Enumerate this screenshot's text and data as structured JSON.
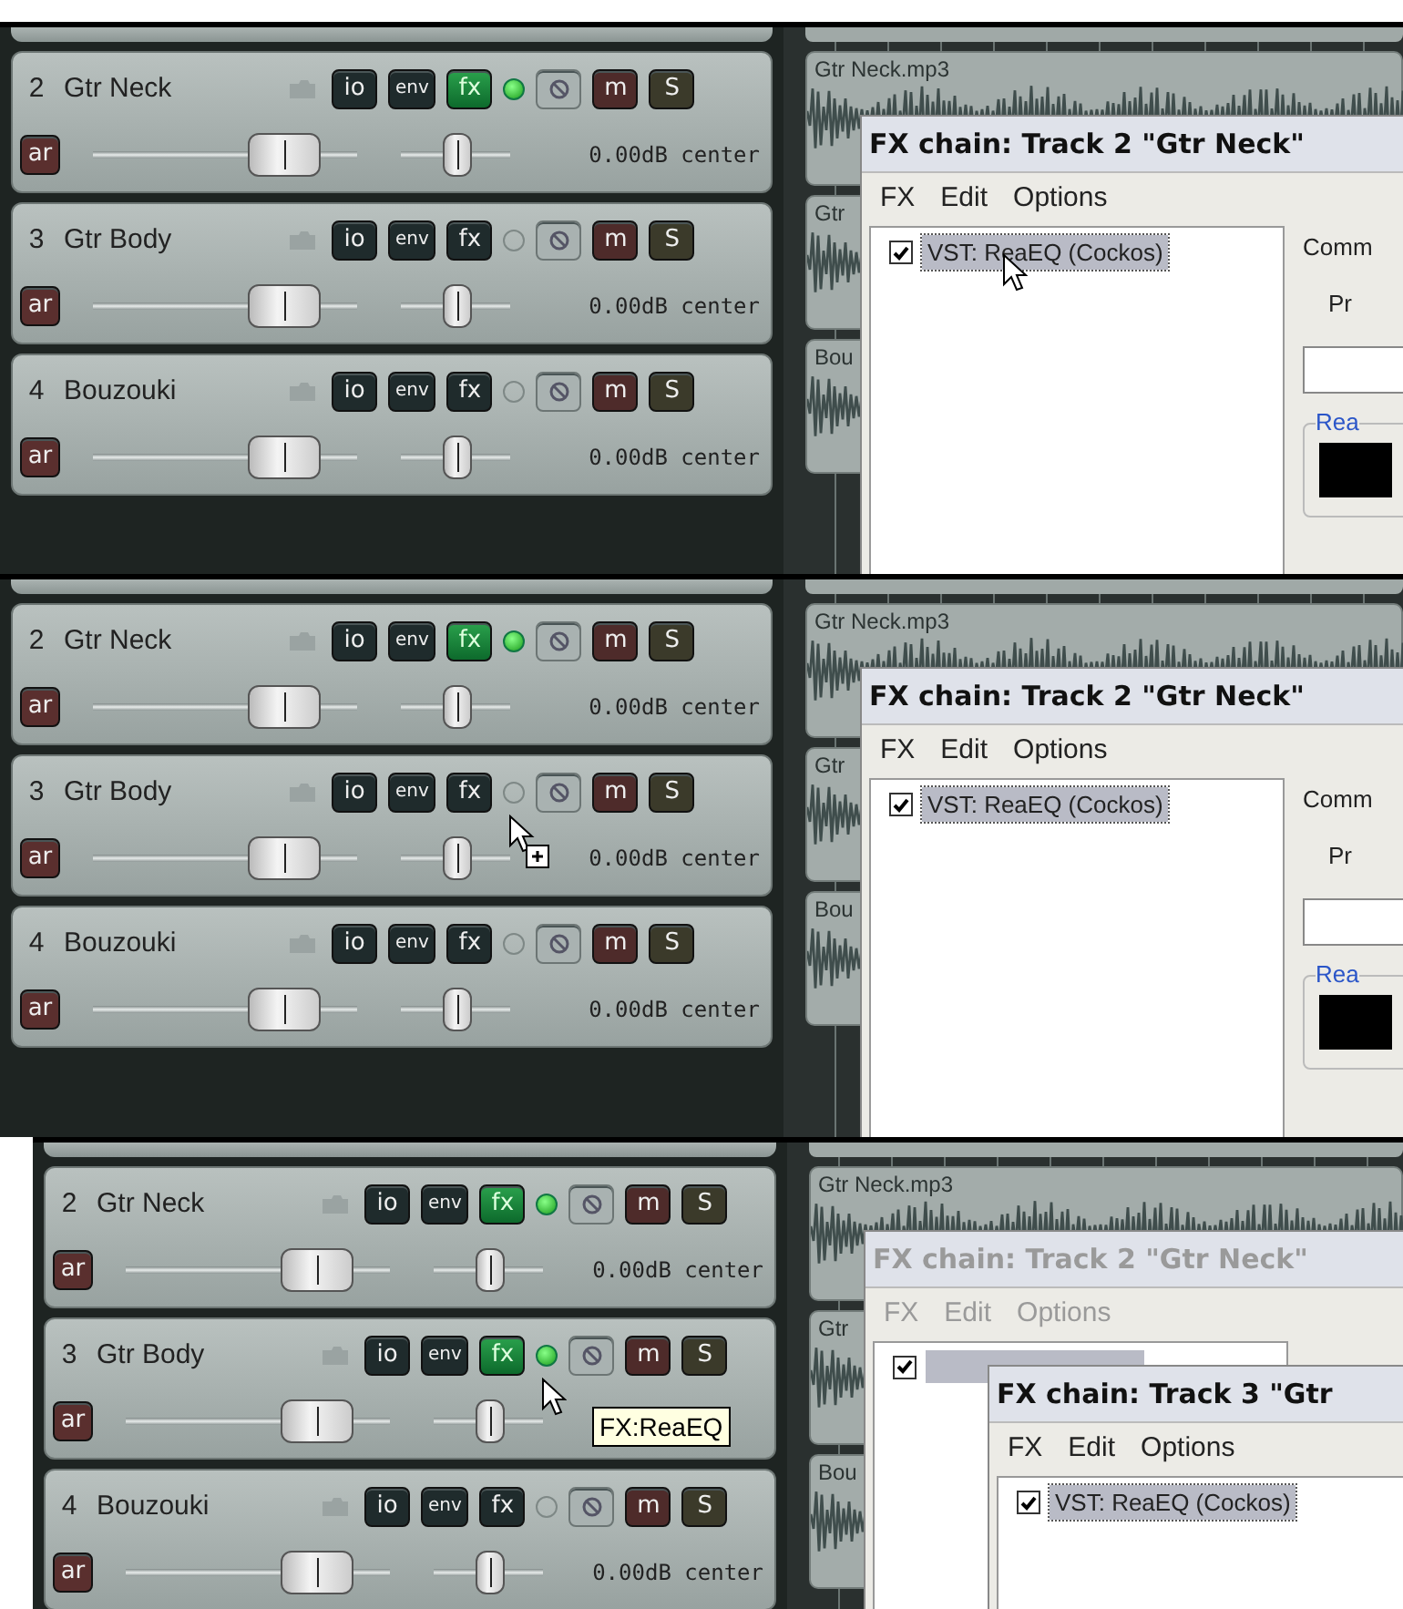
{
  "panels": [
    {
      "tracks": [
        {
          "number": "2",
          "name": "Gtr Neck",
          "io": "io",
          "env": "env",
          "fx": "fx",
          "fx_active": true,
          "m": "m",
          "s": "S",
          "ar": "ar",
          "volume": {
            "level": 0.72
          },
          "pan": {
            "level": 0.5
          },
          "reading": "0.00dB center"
        },
        {
          "number": "3",
          "name": "Gtr Body",
          "io": "io",
          "env": "env",
          "fx": "fx",
          "fx_active": false,
          "m": "m",
          "s": "S",
          "ar": "ar",
          "volume": {
            "level": 0.72
          },
          "pan": {
            "level": 0.5
          },
          "reading": "0.00dB center"
        },
        {
          "number": "4",
          "name": "Bouzouki",
          "io": "io",
          "env": "env",
          "fx": "fx",
          "fx_active": false,
          "m": "m",
          "s": "S",
          "ar": "ar",
          "volume": {
            "level": 0.72
          },
          "pan": {
            "level": 0.5
          },
          "reading": "0.00dB center"
        }
      ],
      "clips": [
        "Gtr Neck.mp3",
        "Gtr",
        "Bou"
      ],
      "fx_windows": [
        {
          "title": "FX chain: Track 2 \"Gtr Neck\"",
          "active": true,
          "menu": [
            "FX",
            "Edit",
            "Options"
          ],
          "items": [
            {
              "label": "VST: ReaEQ (Cockos)",
              "checked": true,
              "selected": true,
              "cursor": {
                "kind": "arrow"
              }
            }
          ],
          "side": {
            "labels": [
              "Comm",
              "Pr"
            ],
            "group": "Rea"
          }
        }
      ]
    },
    {
      "tracks": [
        {
          "number": "2",
          "name": "Gtr Neck",
          "io": "io",
          "env": "env",
          "fx": "fx",
          "fx_active": true,
          "m": "m",
          "s": "S",
          "ar": "ar",
          "volume": {
            "level": 0.72
          },
          "pan": {
            "level": 0.5
          },
          "reading": "0.00dB center"
        },
        {
          "number": "3",
          "name": "Gtr Body",
          "io": "io",
          "env": "env",
          "fx": "fx",
          "fx_active": false,
          "m": "m",
          "s": "S",
          "ar": "ar",
          "volume": {
            "level": 0.72
          },
          "pan": {
            "level": 0.5
          },
          "reading": "0.00dB center",
          "cursor": {
            "kind": "copy"
          }
        },
        {
          "number": "4",
          "name": "Bouzouki",
          "io": "io",
          "env": "env",
          "fx": "fx",
          "fx_active": false,
          "m": "m",
          "s": "S",
          "ar": "ar",
          "volume": {
            "level": 0.72
          },
          "pan": {
            "level": 0.5
          },
          "reading": "0.00dB center"
        }
      ],
      "clips": [
        "Gtr Neck.mp3",
        "Gtr",
        "Bou"
      ],
      "fx_windows": [
        {
          "title": "FX chain: Track 2 \"Gtr Neck\"",
          "active": true,
          "menu": [
            "FX",
            "Edit",
            "Options"
          ],
          "items": [
            {
              "label": "VST: ReaEQ (Cockos)",
              "checked": true,
              "selected": true
            }
          ],
          "side": {
            "labels": [
              "Comm",
              "Pr"
            ],
            "group": "Rea"
          }
        }
      ]
    },
    {
      "tracks": [
        {
          "number": "2",
          "name": "Gtr Neck",
          "io": "io",
          "env": "env",
          "fx": "fx",
          "fx_active": true,
          "m": "m",
          "s": "S",
          "ar": "ar",
          "volume": {
            "level": 0.72
          },
          "pan": {
            "level": 0.5
          },
          "reading": "0.00dB center"
        },
        {
          "number": "3",
          "name": "Gtr Body",
          "io": "io",
          "env": "env",
          "fx": "fx",
          "fx_active": true,
          "m": "m",
          "s": "S",
          "ar": "ar",
          "volume": {
            "level": 0.72
          },
          "pan": {
            "level": 0.5
          },
          "cursor": {
            "kind": "arrow"
          },
          "tooltip": "FX:ReaEQ"
        },
        {
          "number": "4",
          "name": "Bouzouki",
          "io": "io",
          "env": "env",
          "fx": "fx",
          "fx_active": false,
          "m": "m",
          "s": "S",
          "ar": "ar",
          "volume": {
            "level": 0.72
          },
          "pan": {
            "level": 0.5
          },
          "reading": "0.00dB center"
        }
      ],
      "clips": [
        "Gtr Neck.mp3",
        "Gtr",
        "Bou"
      ],
      "fx_windows": [
        {
          "title": "FX chain: Track 2 \"Gtr Neck\"",
          "active": false,
          "menu": [
            "FX",
            "Edit",
            "Options"
          ],
          "items": [
            {
              "checked": true,
              "selected": true
            }
          ]
        },
        {
          "title": "FX chain: Track 3 \"Gtr",
          "active": true,
          "menu": [
            "FX",
            "Edit",
            "Options"
          ],
          "items": [
            {
              "label": "VST: ReaEQ (Cockos)",
              "checked": true,
              "selected": true
            }
          ]
        }
      ]
    }
  ]
}
